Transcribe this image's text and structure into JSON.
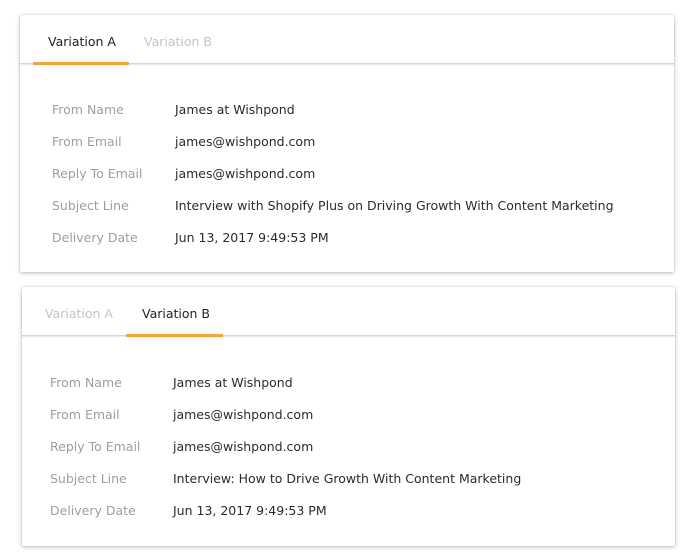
{
  "panels": [
    {
      "tabs": [
        "Variation A",
        "Variation B"
      ],
      "active_tab": "Variation A",
      "fields": [
        {
          "label": "From Name",
          "value": "James at Wishpond"
        },
        {
          "label": "From Email",
          "value": "james@wishpond.com"
        },
        {
          "label": "Reply To Email",
          "value": "james@wishpond.com"
        },
        {
          "label": "Subject Line",
          "value": "Interview with Shopify Plus on Driving Growth With Content Marketing"
        },
        {
          "label": "Delivery Date",
          "value": "Jun 13, 2017 9:49:53 PM"
        }
      ]
    },
    {
      "tabs": [
        "Variation A",
        "Variation B"
      ],
      "active_tab": "Variation B",
      "fields": [
        {
          "label": "From Name",
          "value": "James at Wishpond"
        },
        {
          "label": "From Email",
          "value": "james@wishpond.com"
        },
        {
          "label": "Reply To Email",
          "value": "james@wishpond.com"
        },
        {
          "label": "Subject Line",
          "value": "Interview: How to Drive Growth With Content Marketing"
        },
        {
          "label": "Delivery Date",
          "value": "Jun 13, 2017 9:49:53 PM"
        }
      ]
    }
  ],
  "colors": {
    "accent": "#f5a23d",
    "label": "#9e9e9e",
    "value": "#2b2b2b",
    "inactive_tab": "#c4c4c4"
  }
}
